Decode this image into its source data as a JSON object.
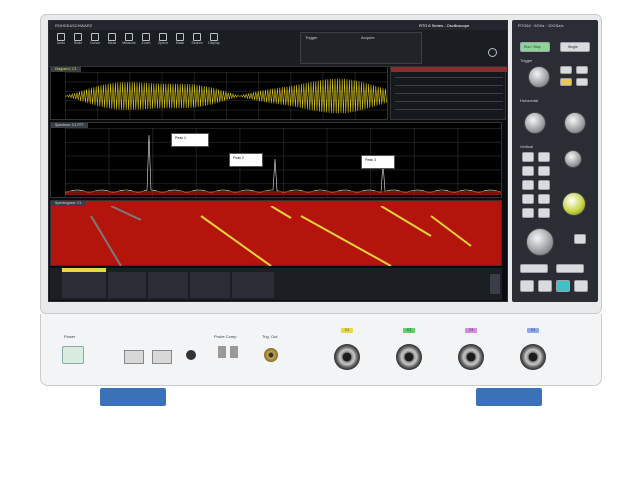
{
  "brand": "ROHDE&SCHWARZ",
  "series_title": "RTO 6 Series - Oscilloscope",
  "model": "RTO64 · 6GHz · 20GSa/s",
  "toolbar": {
    "items": [
      "Undo",
      "Redo",
      "Cursor",
      "Meas",
      "Measure",
      "Zoom",
      "Spectr",
      "Mask",
      "Search",
      "Display"
    ]
  },
  "trigger_info": {
    "label1": "Trigger",
    "label2": "Acquire"
  },
  "panels": {
    "p1_title": "Diagram1: C1",
    "p2_title": "Spectrum: C1 FFT",
    "p3_title": "Spectrogram: C1"
  },
  "peaks": [
    {
      "label": "Peak 1"
    },
    {
      "label": "Peak 2"
    },
    {
      "label": "Peak 3"
    }
  ],
  "controls": {
    "run_stop": "Run / Stop",
    "single": "Single",
    "trigger": "Trigger",
    "horizontal": "Horizontal",
    "vertical": "Vertical",
    "position": "Position",
    "scale": "Scale",
    "multiple": "Multiple"
  },
  "front": {
    "power": "Power",
    "probe_comp": "Probe Comp",
    "ext_trig": "Trig. Out",
    "channels": [
      "C1",
      "C2",
      "C3",
      "C4"
    ],
    "channel_colors": [
      "#e7d84a",
      "#5fcf6a",
      "#d58be2",
      "#8fa9f0"
    ]
  },
  "colors": {
    "wave": "#d9c51e",
    "spectrum": "#ffffff",
    "spectro": "#d61a10"
  }
}
